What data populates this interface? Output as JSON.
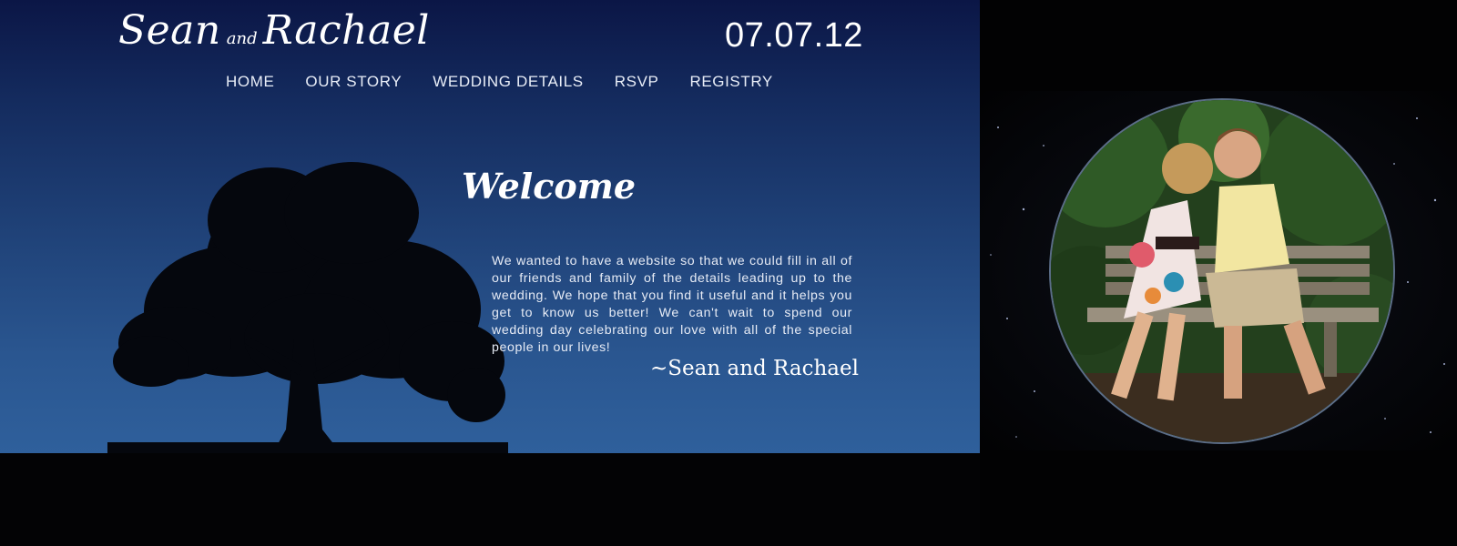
{
  "header": {
    "brand_first": "Sean",
    "brand_and": "and",
    "brand_second": "Rachael",
    "date": "07.07.12"
  },
  "nav": {
    "items": [
      {
        "label": "HOME"
      },
      {
        "label": "OUR STORY"
      },
      {
        "label": "WEDDING DETAILS"
      },
      {
        "label": "RSVP"
      },
      {
        "label": "REGISTRY"
      }
    ]
  },
  "main": {
    "heading": "Welcome",
    "body": "We wanted to have a website so that we could fill in all of our friends and family of the details leading up to the wedding. We hope that you find it useful and it helps you get to know us better! We can't wait to spend our wedding day celebrating our love with all of the special people in our lives!",
    "signature": "~Sean and Rachael"
  },
  "colors": {
    "panel_top": "#0b1646",
    "panel_bottom": "#2f609c",
    "text": "#ffffff"
  },
  "images": {
    "tree": "tree-silhouette",
    "couple_photo": "couple-photo"
  }
}
